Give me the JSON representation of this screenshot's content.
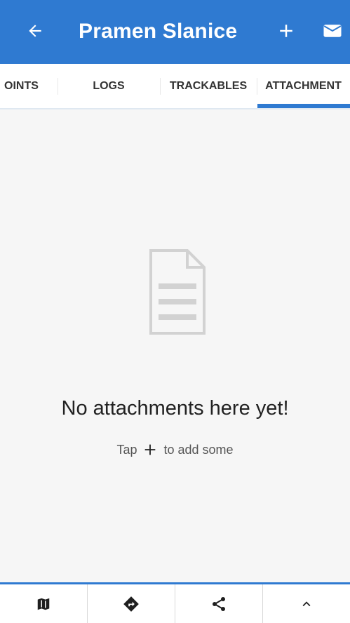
{
  "app_bar": {
    "title": "Pramen Slanice",
    "back_icon": "arrow-left-icon",
    "add_icon": "plus-icon",
    "mail_icon": "envelope-icon",
    "color": "#2f7ad1"
  },
  "tabs": [
    {
      "label": "OINTS",
      "active": false
    },
    {
      "label": "LOGS",
      "active": false
    },
    {
      "label": "TRACKABLES",
      "active": false
    },
    {
      "label": "ATTACHMENT",
      "active": true
    }
  ],
  "empty_state": {
    "icon": "document-icon",
    "title": "No attachments here yet!",
    "hint_before": "Tap",
    "hint_icon": "plus-icon",
    "hint_after": "to add some"
  },
  "bottom_bar": [
    {
      "icon": "map-icon"
    },
    {
      "icon": "navigate-icon"
    },
    {
      "icon": "share-icon"
    },
    {
      "icon": "chevron-up-icon"
    }
  ]
}
